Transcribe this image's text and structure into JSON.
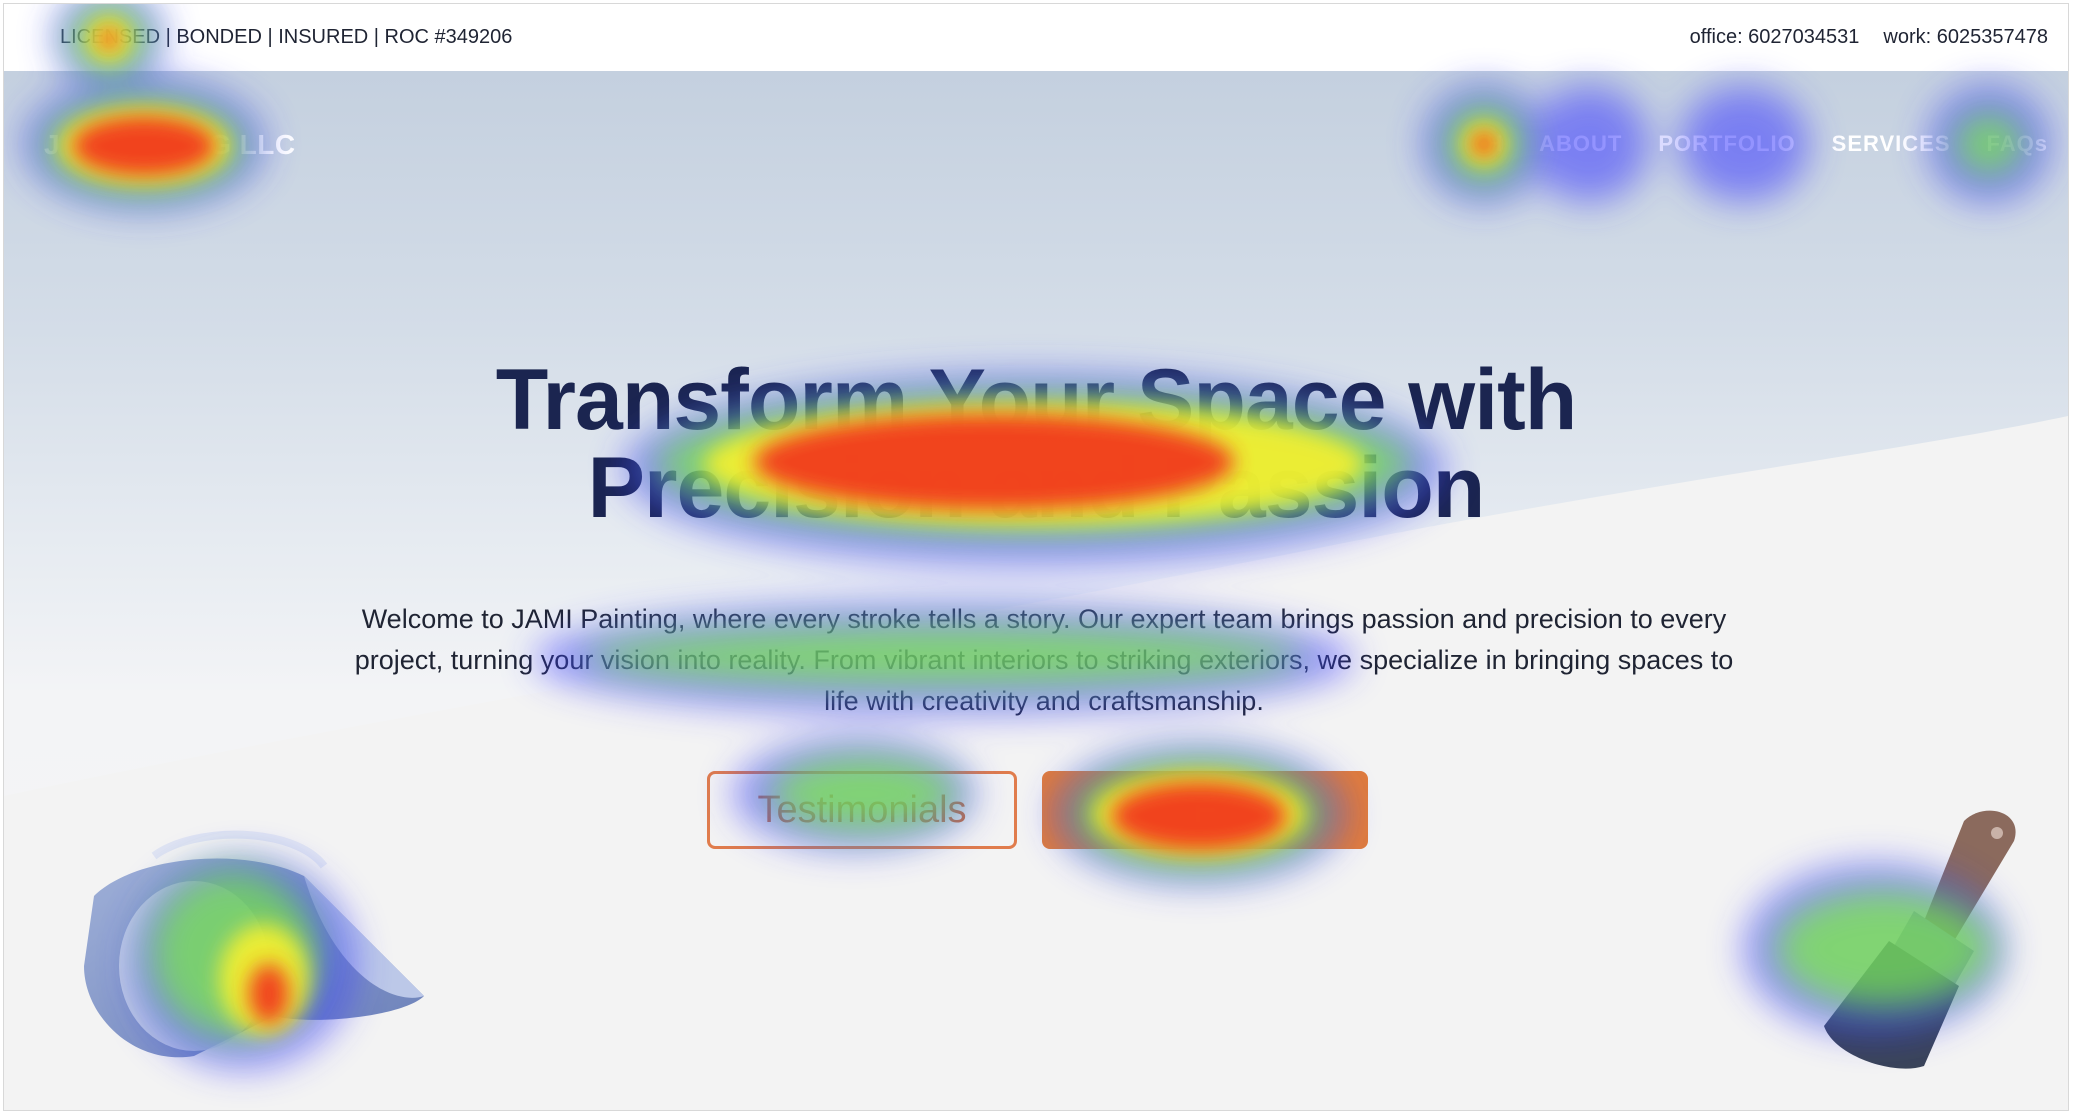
{
  "topbar": {
    "credentials": "LICENSED | BONDED | INSURED | ROC #349206",
    "office": "office: 6027034531",
    "work": "work: 6025357478"
  },
  "header": {
    "brand": "J                  G LLC",
    "nav": [
      "H",
      "ABOUT",
      "PORTFOLIO",
      "SERVICES",
      "FAQs"
    ]
  },
  "hero": {
    "headline_line1": "Transform Your Space with",
    "headline_line2": "Precision and Passion",
    "intro": "Welcome to JAMI Painting, where every stroke tells a story. Our expert team brings passion and precision to every project, turning your vision into reality. From vibrant interiors to striking exteriors, we specialize in bringing spaces to life with creativity and craftsmanship.",
    "button_testimonials": "Testimonials",
    "button_primary": "F"
  },
  "colors": {
    "headline": "#1b2550",
    "accent": "#e07c3c",
    "text": "#1f2433"
  },
  "icons": [
    "paint-bucket-icon",
    "paint-brush-icon"
  ]
}
